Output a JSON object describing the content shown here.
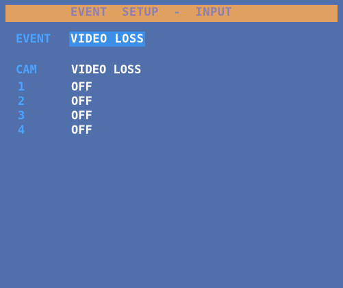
{
  "header": {
    "title": "EVENT  SETUP  -  INPUT"
  },
  "event": {
    "label": "EVENT",
    "value": "VIDEO LOSS"
  },
  "table": {
    "columns": [
      "CAM",
      "VIDEO LOSS"
    ],
    "rows": [
      {
        "cam": "1",
        "state": "OFF"
      },
      {
        "cam": "2",
        "state": "OFF"
      },
      {
        "cam": "3",
        "state": "OFF"
      },
      {
        "cam": "4",
        "state": "OFF"
      }
    ]
  },
  "colors": {
    "background": "#516fab",
    "title_bar": "#e0a060",
    "title_text": "#8f7fae",
    "label_blue": "#4aa3ff",
    "highlight": "#3b8fe8",
    "value_text": "#ffffff"
  }
}
